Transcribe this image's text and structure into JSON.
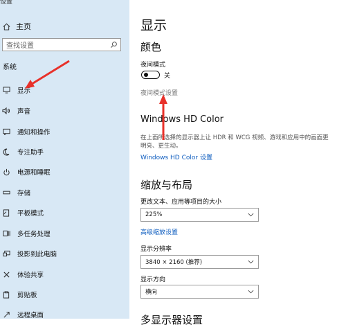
{
  "sidebar": {
    "window_title": "设置",
    "home_label": "主页",
    "search_placeholder": "查找设置",
    "section": "系统",
    "items": [
      {
        "label": "显示",
        "icon": "monitor-icon"
      },
      {
        "label": "声音",
        "icon": "speaker-icon"
      },
      {
        "label": "通知和操作",
        "icon": "notification-icon"
      },
      {
        "label": "专注助手",
        "icon": "moon-icon"
      },
      {
        "label": "电源和睡眠",
        "icon": "power-icon"
      },
      {
        "label": "存储",
        "icon": "storage-icon"
      },
      {
        "label": "平板模式",
        "icon": "tablet-icon"
      },
      {
        "label": "多任务处理",
        "icon": "multitask-icon"
      },
      {
        "label": "投影到此电脑",
        "icon": "project-icon"
      },
      {
        "label": "体验共享",
        "icon": "share-icon"
      },
      {
        "label": "剪贴板",
        "icon": "clipboard-icon"
      },
      {
        "label": "远程桌面",
        "icon": "remote-icon"
      }
    ]
  },
  "main": {
    "page_title": "显示",
    "color_heading": "颜色",
    "night_mode_label": "夜间模式",
    "night_mode_state": "关",
    "night_mode_settings_link": "夜间模式设置",
    "hdr_heading": "Windows HD Color",
    "hdr_desc": "在上面所选择的显示器上让 HDR 和 WCG 视频、游戏和应用中的画面更明亮、更生动。",
    "hdr_link": "Windows HD Color 设置",
    "scale_heading": "缩放与布局",
    "text_size_label": "更改文本、应用等项目的大小",
    "text_size_value": "225%",
    "advanced_scaling_link": "高级缩放设置",
    "resolution_label": "显示分辨率",
    "resolution_value": "3840 × 2160 (推荐)",
    "orientation_label": "显示方向",
    "orientation_value": "横向",
    "multi_display_heading": "多显示器设置"
  },
  "colors": {
    "sidebar_bg": "#d8e8f5",
    "link": "#0d5cbf",
    "annotation_arrow": "#e8312a"
  }
}
